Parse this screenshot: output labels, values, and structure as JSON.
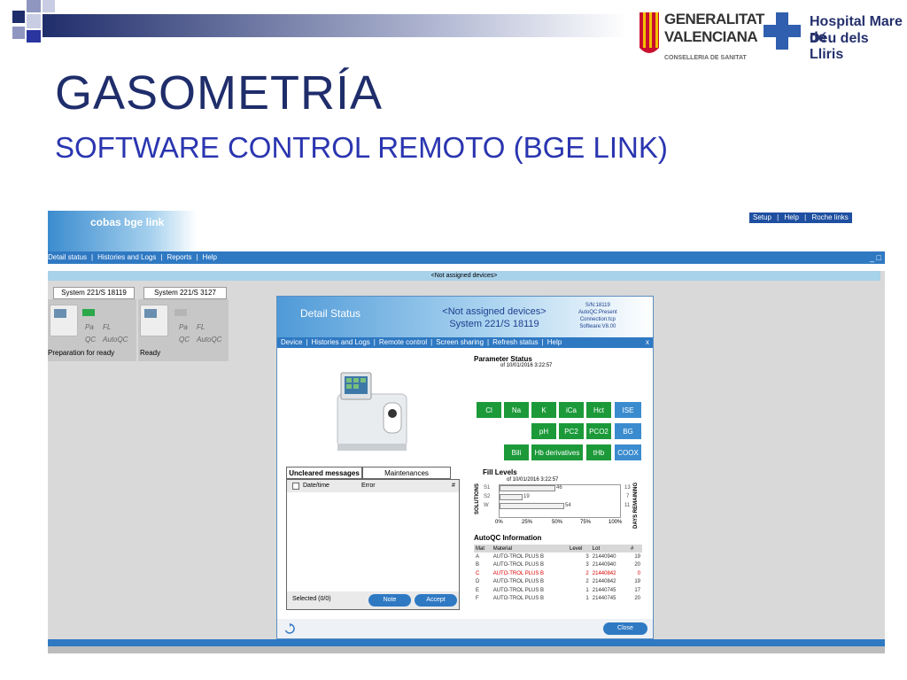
{
  "slide": {
    "title": "GASOMETRÍA",
    "subtitle": "SOFTWARE CONTROL REMOTO (BGE LINK)"
  },
  "logos": {
    "gv_line1": "GENERALITAT",
    "gv_line2": "VALENCIANA",
    "gv_line3": "CONSELLERIA DE SANITAT",
    "hosp_line1": "Hospital Mare de",
    "hosp_line2": "Déu dels Lliris"
  },
  "app": {
    "brand": "cobas bge link",
    "top_links": [
      "Setup",
      "Help",
      "Roche links"
    ],
    "menu": [
      "Detail status",
      "Histories and Logs",
      "Reports",
      "Help"
    ],
    "window_controls": "_ □",
    "not_assigned": "<Not assigned devices>",
    "devices": [
      {
        "tab": "System 221/S 18119",
        "pa": "Pa",
        "fl": "FL",
        "qc": "QC",
        "autoqc": "AutoQC",
        "status": "Preparation for ready"
      },
      {
        "tab": "System 221/S 3127",
        "pa": "Pa",
        "fl": "FL",
        "qc": "QC",
        "autoqc": "AutoQC",
        "status": "Ready"
      }
    ]
  },
  "detail": {
    "title": "Detail Status",
    "center_line1": "<Not assigned devices>",
    "center_line2": "System 221/S 18119",
    "info": [
      "S/N:18119",
      "AutoQC:Present",
      "Connection:tcp",
      "Software:V8.00"
    ],
    "menu": [
      "Device",
      "Histories and Logs",
      "Remote control",
      "Screen sharing",
      "Refresh status",
      "Help"
    ],
    "close_x": "x",
    "param_status_title": "Parameter Status",
    "param_status_date": "of 10/01/2016 3:22:57",
    "params_row1": [
      "Cl",
      "Na",
      "K",
      "iCa",
      "Hct"
    ],
    "params_row2": [
      "pH",
      "PC2",
      "PCO2"
    ],
    "params_row3": [
      "Bili",
      "Hb derivatives",
      "tHb"
    ],
    "groups": [
      "ISE",
      "BG",
      "COOX"
    ],
    "colors": {
      "param_green": "#1c9a3a",
      "group_blue": "#3b8ccf",
      "accent_blue": "#2f79c3"
    },
    "messages": {
      "tab_active": "Uncleared messages",
      "tab_other": "Maintenances",
      "col_date": "Date/time",
      "col_error": "Error",
      "col_num": "#",
      "selected": "Selected (0/0)",
      "note_btn": "Note",
      "accept_btn": "Accept"
    },
    "fill_levels": {
      "title": "Fill Levels",
      "date": "of 10/01/2016 3:22:57",
      "y_label": "SOLUTIONS",
      "right_label": "DAYS REMAINING",
      "solutions": [
        {
          "name": "S1",
          "value": 46,
          "days": "13"
        },
        {
          "name": "S2",
          "value": 19,
          "days": "7"
        },
        {
          "name": "W",
          "value": 54,
          "days": "11"
        }
      ],
      "ticks": [
        "0%",
        "25%",
        "50%",
        "75%",
        "100%"
      ]
    },
    "autoqc": {
      "title": "AutoQC Information",
      "headers": [
        "Mat",
        "Material",
        "Level",
        "Lot",
        "#"
      ],
      "rows": [
        {
          "mat": "A",
          "material": "AUTO-TROL PLUS B",
          "level": "3",
          "lot": "21440940",
          "num": "19",
          "alert": false
        },
        {
          "mat": "B",
          "material": "AUTO-TROL PLUS B",
          "level": "3",
          "lot": "21440940",
          "num": "20",
          "alert": false
        },
        {
          "mat": "C",
          "material": "AUTO-TROL PLUS B",
          "level": "2",
          "lot": "21440842",
          "num": "0",
          "alert": true
        },
        {
          "mat": "D",
          "material": "AUTO-TROL PLUS B",
          "level": "2",
          "lot": "21440842",
          "num": "19",
          "alert": false
        },
        {
          "mat": "E",
          "material": "AUTO-TROL PLUS B",
          "level": "1",
          "lot": "21440745",
          "num": "17",
          "alert": false
        },
        {
          "mat": "F",
          "material": "AUTO-TROL PLUS B",
          "level": "1",
          "lot": "21440745",
          "num": "20",
          "alert": false
        }
      ]
    },
    "close_btn": "Close"
  }
}
